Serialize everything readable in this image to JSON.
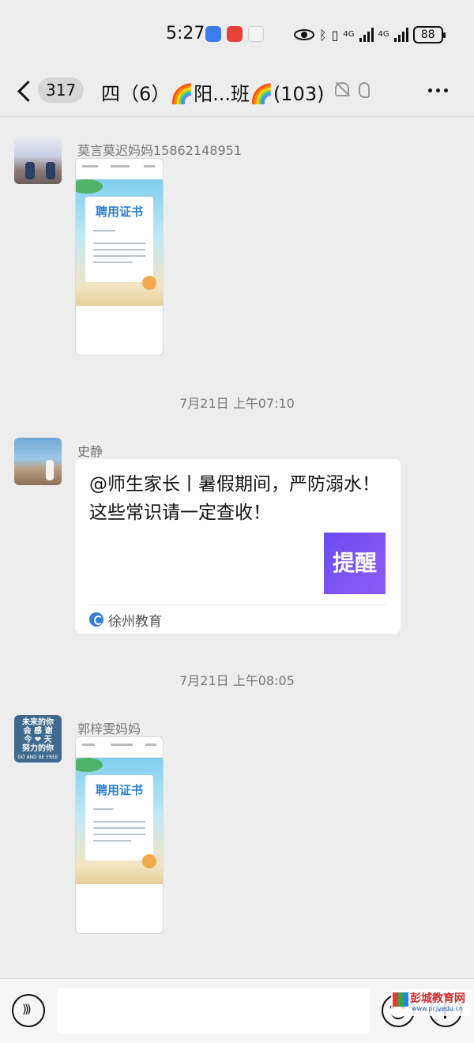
{
  "status_bar": {
    "time": "5:27",
    "network_1": "4G",
    "network_2": "4G",
    "battery": "88"
  },
  "header": {
    "unread_count": "317",
    "title": "四（6）🌈阳...班🌈(103)"
  },
  "messages": [
    {
      "type": "image",
      "sender": "莫言莫迟妈妈15862148951",
      "image_title": "聘用证书"
    },
    {
      "type": "timestamp",
      "text": "7月21日 上午07:10"
    },
    {
      "type": "link",
      "sender": "史静",
      "title": "@师生家长丨暑假期间，严防溺水！这些常识请一定查收！",
      "thumbnail_text": "提醒",
      "source": "徐州教育"
    },
    {
      "type": "timestamp",
      "text": "7月21日 上午08:05"
    },
    {
      "type": "image",
      "sender": "郭梓雯妈妈",
      "image_title": "聘用证书",
      "avatar_text": [
        "未来的你",
        "会 感 谢",
        "今 ❤ 天",
        "努力的你",
        "GO AND BE FREE"
      ]
    }
  ],
  "watermark": {
    "name": "彭城教育网",
    "url": "www.pcjyedu.cn"
  },
  "colors": {
    "background": "#ededed",
    "card": "#ffffff",
    "thumb_purple": "#6a4cf0"
  }
}
